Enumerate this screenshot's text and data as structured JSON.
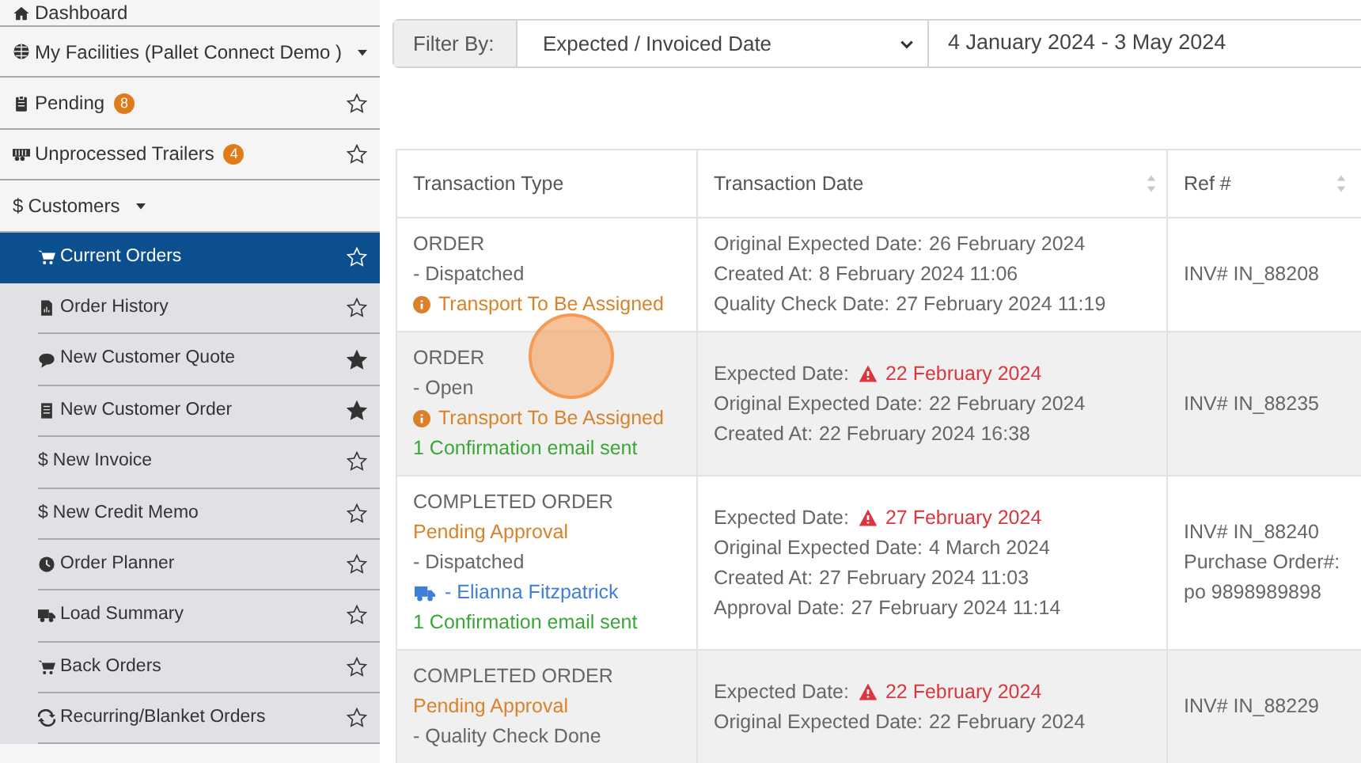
{
  "sidebar": {
    "items": [
      {
        "label": "Dashboard",
        "selected": false
      },
      {
        "label": "My Facilities (Pallet Connect Demo )",
        "dropdown": true,
        "selected": false
      },
      {
        "label": "Pending",
        "badge": "8",
        "starred": false,
        "selected": false
      },
      {
        "label": "Unprocessed Trailers",
        "badge": "4",
        "starred": false,
        "selected": false
      },
      {
        "glyph": "$",
        "label": "Customers",
        "dropdown": true,
        "expanded": true,
        "selected": false,
        "children": [
          {
            "label": "Current Orders",
            "starred": false,
            "selected": true
          },
          {
            "label": "Order History",
            "starred": false,
            "selected": false
          },
          {
            "label": "New Customer Quote",
            "starred": true,
            "selected": false
          },
          {
            "label": "New Customer Order",
            "starred": true,
            "selected": false
          },
          {
            "glyph": "$",
            "label": "New Invoice",
            "starred": false,
            "selected": false
          },
          {
            "glyph": "$",
            "label": "New Credit Memo",
            "starred": false,
            "selected": false
          },
          {
            "label": "Order Planner",
            "starred": false,
            "selected": false
          },
          {
            "label": "Load Summary",
            "starred": false,
            "selected": false
          },
          {
            "label": "Back Orders",
            "starred": false,
            "selected": false
          },
          {
            "label": "Recurring/Blanket Orders",
            "starred": false,
            "selected": false
          }
        ]
      }
    ]
  },
  "filter": {
    "label": "Filter By:",
    "select_value": "Expected / Invoiced Date",
    "date_range": "4 January 2024 - 3 May 2024"
  },
  "table": {
    "columns": [
      {
        "label": "Transaction Type",
        "sortable": false
      },
      {
        "label": "Transaction Date",
        "sortable": true
      },
      {
        "label": "Ref #",
        "sortable": true
      }
    ],
    "rows": [
      {
        "type_lines": [
          {
            "kind": "plain",
            "text": "ORDER"
          },
          {
            "kind": "plain",
            "text": "- Dispatched"
          },
          {
            "kind": "transport",
            "text": "Transport To Be Assigned"
          }
        ],
        "date_lines": [
          {
            "kind": "plain",
            "label": "Original Expected Date:",
            "value": "26 February 2024"
          },
          {
            "kind": "plain",
            "label": "Created At:",
            "value": "8 February 2024 11:06"
          },
          {
            "kind": "plain",
            "label": "Quality Check Date:",
            "value": "27 February 2024 11:19"
          }
        ],
        "ref_lines": [
          "INV# IN_88208"
        ]
      },
      {
        "type_lines": [
          {
            "kind": "plain",
            "text": "ORDER"
          },
          {
            "kind": "plain",
            "text": "- Open"
          },
          {
            "kind": "transport",
            "text": "Transport To Be Assigned"
          },
          {
            "kind": "email",
            "text": "1 Confirmation email sent"
          }
        ],
        "date_lines": [
          {
            "kind": "overdue",
            "label": "Expected Date:",
            "value": "22 February 2024"
          },
          {
            "kind": "plain",
            "label": "Original Expected Date:",
            "value": "22 February 2024"
          },
          {
            "kind": "plain",
            "label": "Created At:",
            "value": "22 February 2024 16:38"
          }
        ],
        "ref_lines": [
          "INV# IN_88235"
        ]
      },
      {
        "type_lines": [
          {
            "kind": "plain",
            "text": "COMPLETED ORDER"
          },
          {
            "kind": "pending",
            "text": "Pending Approval"
          },
          {
            "kind": "plain",
            "text": "- Dispatched"
          },
          {
            "kind": "driver",
            "text": "- Elianna Fitzpatrick"
          },
          {
            "kind": "email",
            "text": "1 Confirmation email sent"
          }
        ],
        "date_lines": [
          {
            "kind": "overdue",
            "label": "Expected Date:",
            "value": "27 February 2024"
          },
          {
            "kind": "plain",
            "label": "Original Expected Date:",
            "value": "4 March 2024"
          },
          {
            "kind": "plain",
            "label": "Created At:",
            "value": "27 February 2024 11:03"
          },
          {
            "kind": "plain",
            "label": "Approval Date:",
            "value": "27 February 2024 11:14"
          }
        ],
        "ref_lines": [
          "INV# IN_88240",
          "Purchase Order#:",
          "po 9898989898"
        ]
      },
      {
        "type_lines": [
          {
            "kind": "plain",
            "text": "COMPLETED ORDER"
          },
          {
            "kind": "pending",
            "text": "Pending Approval"
          },
          {
            "kind": "plain",
            "text": "- Quality Check Done"
          }
        ],
        "date_lines": [
          {
            "kind": "overdue",
            "label": "Expected Date:",
            "value": "22 February 2024"
          },
          {
            "kind": "plain",
            "label": "Original Expected Date:",
            "value": "22 February 2024"
          }
        ],
        "ref_lines": [
          "INV# IN_88229"
        ]
      }
    ]
  }
}
